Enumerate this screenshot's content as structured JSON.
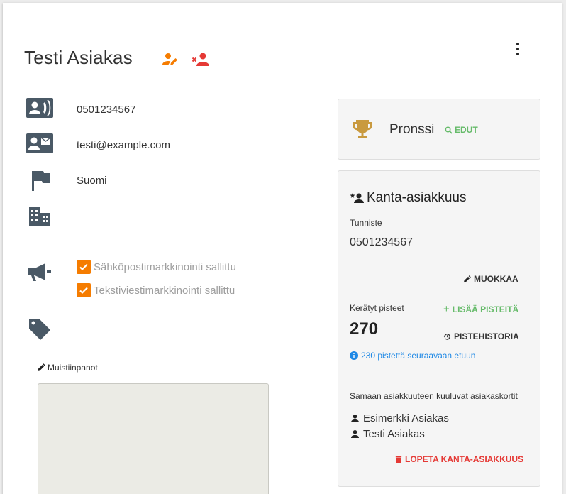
{
  "customer": {
    "name": "Testi Asiakas",
    "phone": "0501234567",
    "email": "testi@example.com",
    "country": "Suomi"
  },
  "marketing": {
    "email_label": "Sähköpostimarkkinointi sallittu",
    "email_checked": true,
    "sms_label": "Tekstiviestimarkkinointi sallittu",
    "sms_checked": true
  },
  "notes": {
    "label": "Muistiinpanot",
    "value": ""
  },
  "tier": {
    "name": "Pronssi",
    "benefits_label": "EDUT"
  },
  "loyalty": {
    "title": "Kanta-asiakkuus",
    "id_label": "Tunniste",
    "id_value": "0501234567",
    "edit_label": "MUOKKAA",
    "points_label": "Kerätyt pisteet",
    "points_value": "270",
    "add_points_label": "LISÄÄ PISTEITÄ",
    "history_label": "PISTEHISTORIA",
    "next_benefit_info": "230 pistettä seuraavaan etuun",
    "linked_cards_label": "Samaan asiakkuuteen kuuluvat asiakaskortit",
    "linked_cards": [
      "Esimerkki Asiakas",
      "Testi Asiakas"
    ],
    "end_label": "LOPETA KANTA-ASIAKKUUS"
  },
  "colors": {
    "accent_orange": "#f57c00",
    "danger_red": "#e53935",
    "success_green": "#66bb6a",
    "info_blue": "#1e88e5",
    "icon_slate": "#4a5966",
    "trophy_gold": "#c99a3f"
  }
}
